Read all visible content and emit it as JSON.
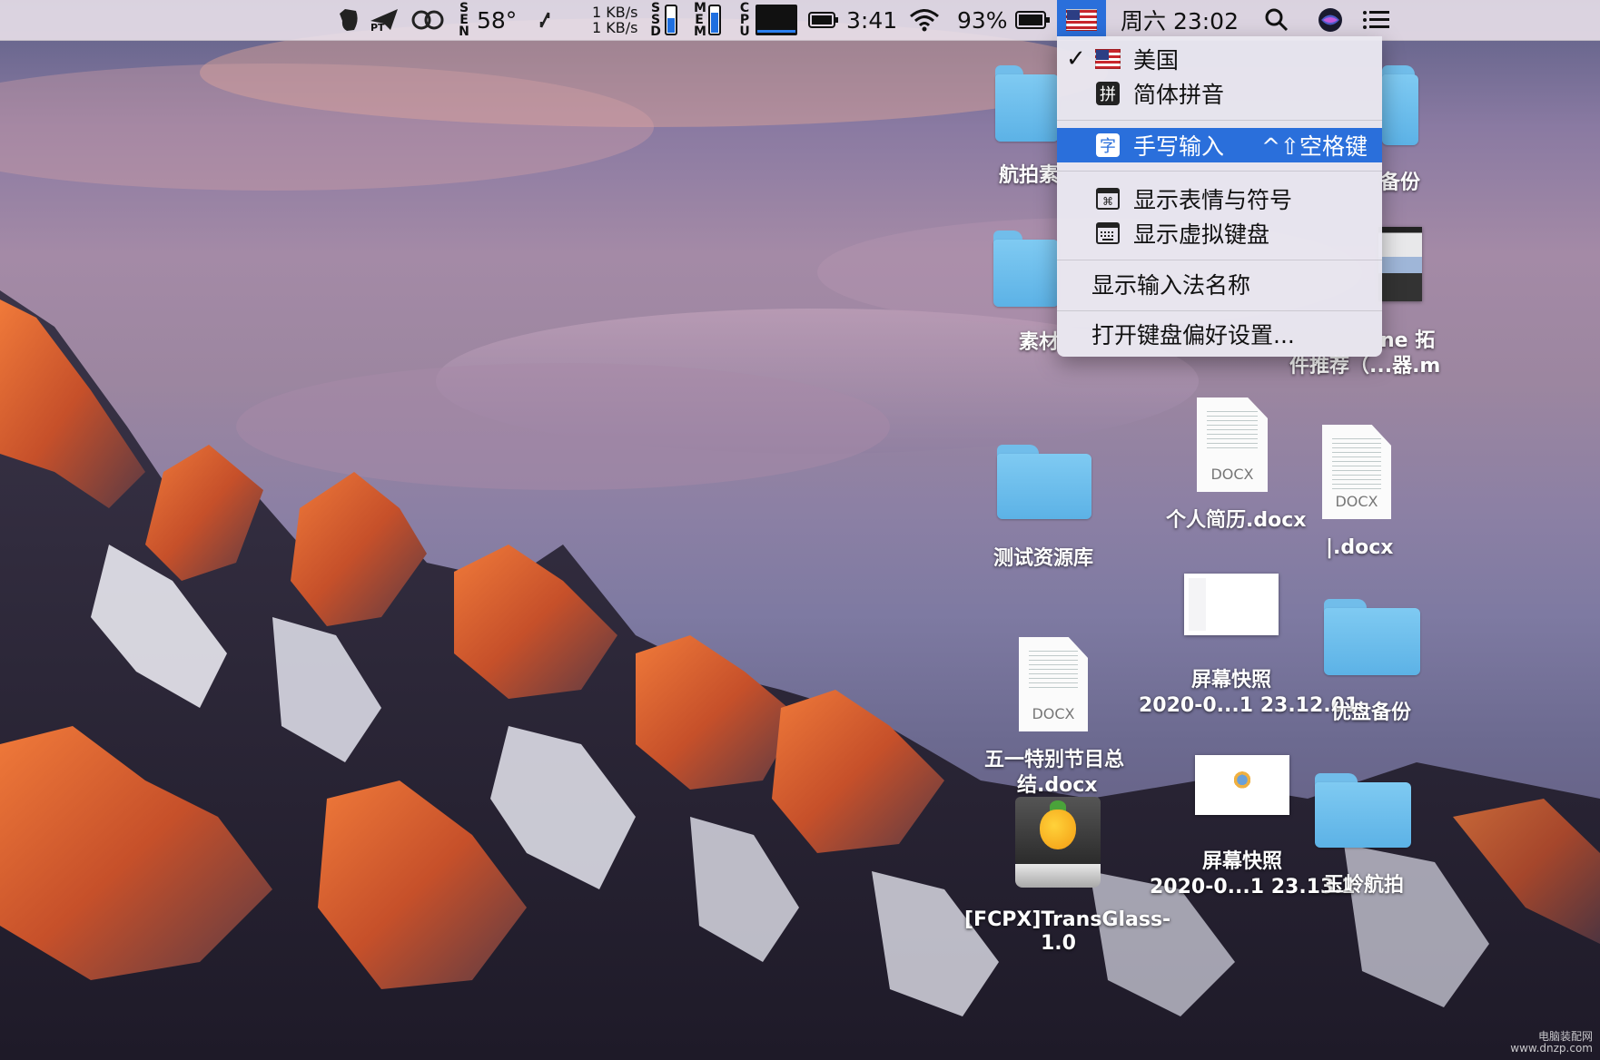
{
  "menubar": {
    "temperature": "58°",
    "net_up": "1 KB/s",
    "net_down": "1 KB/s",
    "sen_label": [
      "S",
      "E",
      "N"
    ],
    "ssd_label": [
      "S",
      "S",
      "D"
    ],
    "mem_label": [
      "M",
      "E",
      "M"
    ],
    "cpu_label": [
      "C",
      "P",
      "U"
    ],
    "battery_time": "3:41",
    "battery_percent": "93%",
    "datetime": "周六 23:02",
    "pt_label": "PT"
  },
  "input_menu": {
    "items": [
      {
        "label": "美国",
        "checked": true,
        "icon": "us-flag-icon"
      },
      {
        "label": "简体拼音",
        "icon": "pinyin-icon",
        "icon_text": "拼"
      },
      {
        "label": "手写输入",
        "icon": "handwriting-icon",
        "icon_text": "字",
        "shortcut": "^⇧空格键",
        "selected": true
      },
      {
        "label": "显示表情与符号",
        "icon": "emoji-symbols-icon"
      },
      {
        "label": "显示虚拟键盘",
        "icon": "virtual-keyboard-icon"
      },
      {
        "label": "显示输入法名称"
      },
      {
        "label": "打开键盘偏好设置..."
      }
    ],
    "check_mark": "✓"
  },
  "desktop": {
    "folder_aerial": "航拍素",
    "folder_material": "素材",
    "folder_test_library": "测试资源库",
    "doc_resume": "个人简历.docx",
    "doc_resume_kind": "DOCX",
    "doc_pipe": "|.docx",
    "doc_pipe_kind": "DOCX",
    "right_backup_partial": "备份",
    "right_partial_line1": "ne 拓",
    "right_partial_line2": "件推荐（...器.m",
    "shot1_line1": "屏幕快照",
    "shot1_line2": "2020-0...1 23.12.01",
    "folder_youpan": "优盘备份",
    "doc_wuyi_kind": "DOCX",
    "doc_wuyi_line1": "五一特别节目总",
    "doc_wuyi_line2": "结.docx",
    "shot2_line1": "屏幕快照",
    "shot2_line2": "2020-0...1 23.13.2",
    "folder_yuling": "玉岭航拍",
    "drive_label": "[FCPX]TransGlass-",
    "drive_label2": "1.0"
  },
  "watermark": {
    "line1": "电脑装配网",
    "line2": "www.dnzp.com"
  }
}
